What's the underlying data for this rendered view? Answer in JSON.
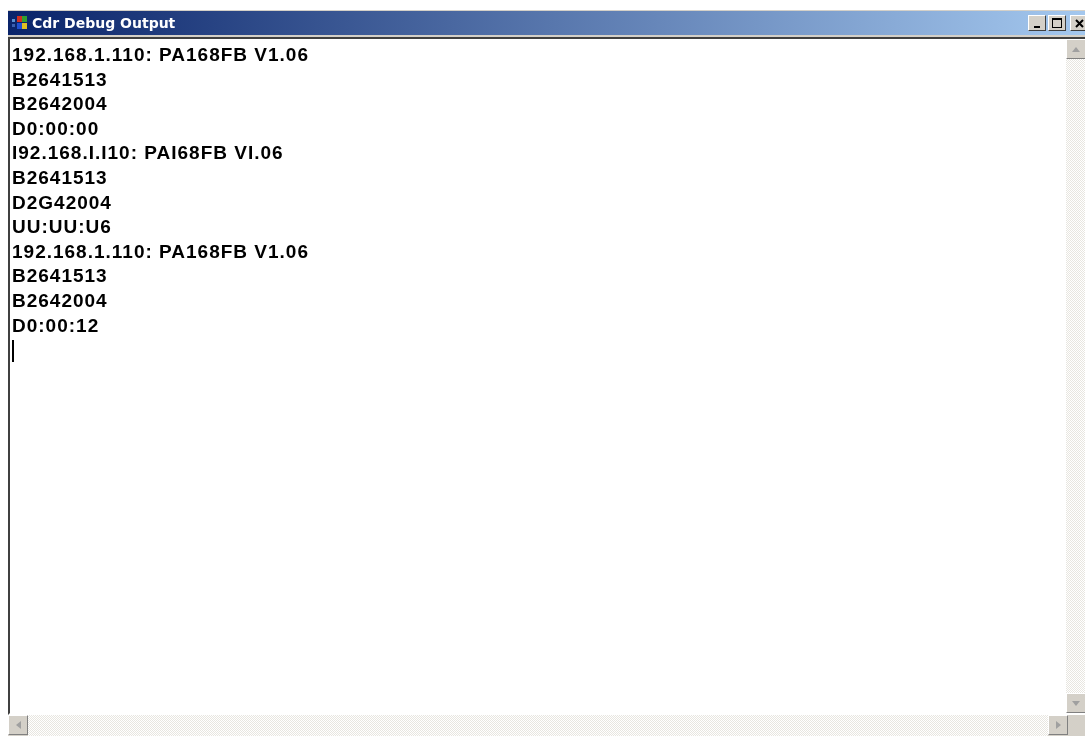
{
  "window": {
    "title": "Cdr Debug Output"
  },
  "output_lines": [
    "192.168.1.110: PA168FB V1.06",
    "B2641513",
    "B2642004",
    "D0:00:00",
    "I92.168.I.I10: PAI68FB VI.06",
    "B2641513",
    "D2G42004",
    "UU:UU:U6",
    "192.168.1.110: PA168FB V1.06",
    "B2641513",
    "B2642004",
    "D0:00:12"
  ]
}
